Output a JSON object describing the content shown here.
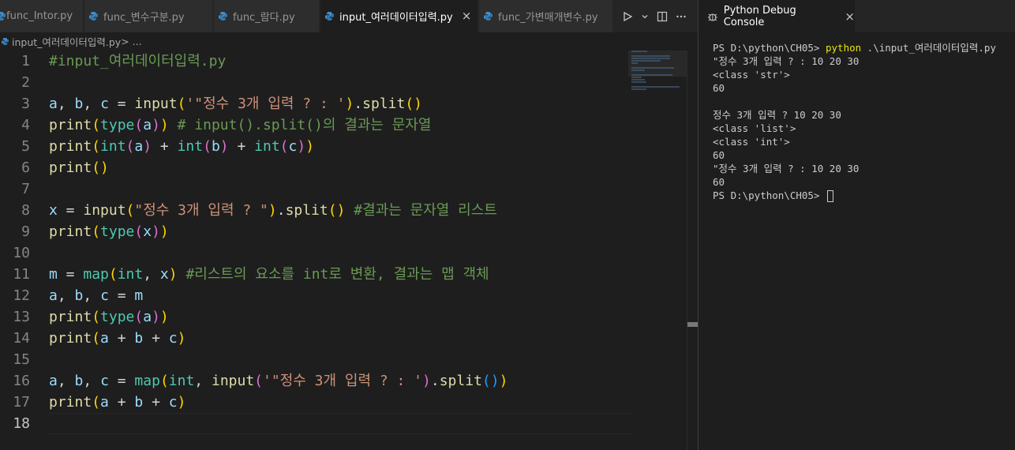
{
  "tabs": [
    {
      "label": "func_Intor.py",
      "active": false
    },
    {
      "label": "func_변수구분.py",
      "active": false
    },
    {
      "label": "func_람다.py",
      "active": false
    },
    {
      "label": "input_여러데이터입력.py",
      "active": true
    },
    {
      "label": "func_가변매개변수.py",
      "active": false
    }
  ],
  "tab_close_glyph": "×",
  "breadcrumb": {
    "file": "input_여러데이터입력.py",
    "rest": " > ..."
  },
  "editor": {
    "current_line": 18,
    "lines": [
      {
        "n": "1",
        "segments": [
          {
            "t": "#input_여러데이터입력.py",
            "c": "com"
          }
        ]
      },
      {
        "n": "2",
        "segments": []
      },
      {
        "n": "3",
        "segments": [
          {
            "t": "a",
            "c": "var"
          },
          {
            "t": ", ",
            "c": "op"
          },
          {
            "t": "b",
            "c": "var"
          },
          {
            "t": ", ",
            "c": "op"
          },
          {
            "t": "c",
            "c": "var"
          },
          {
            "t": " = ",
            "c": "op"
          },
          {
            "t": "input",
            "c": "fn"
          },
          {
            "t": "(",
            "c": "p1"
          },
          {
            "t": "'\"정수 3개 입력 ? : '",
            "c": "str"
          },
          {
            "t": ")",
            "c": "p1"
          },
          {
            "t": ".",
            "c": "op"
          },
          {
            "t": "split",
            "c": "fn"
          },
          {
            "t": "()",
            "c": "p1"
          }
        ]
      },
      {
        "n": "4",
        "segments": [
          {
            "t": "print",
            "c": "fn"
          },
          {
            "t": "(",
            "c": "p1"
          },
          {
            "t": "type",
            "c": "type"
          },
          {
            "t": "(",
            "c": "p2"
          },
          {
            "t": "a",
            "c": "var"
          },
          {
            "t": ")",
            "c": "p2"
          },
          {
            "t": ")",
            "c": "p1"
          },
          {
            "t": " # input().split()의 결과는 문자열",
            "c": "com"
          }
        ]
      },
      {
        "n": "5",
        "segments": [
          {
            "t": "print",
            "c": "fn"
          },
          {
            "t": "(",
            "c": "p1"
          },
          {
            "t": "int",
            "c": "type"
          },
          {
            "t": "(",
            "c": "p2"
          },
          {
            "t": "a",
            "c": "var"
          },
          {
            "t": ")",
            "c": "p2"
          },
          {
            "t": " + ",
            "c": "op"
          },
          {
            "t": "int",
            "c": "type"
          },
          {
            "t": "(",
            "c": "p2"
          },
          {
            "t": "b",
            "c": "var"
          },
          {
            "t": ")",
            "c": "p2"
          },
          {
            "t": " + ",
            "c": "op"
          },
          {
            "t": "int",
            "c": "type"
          },
          {
            "t": "(",
            "c": "p2"
          },
          {
            "t": "c",
            "c": "var"
          },
          {
            "t": ")",
            "c": "p2"
          },
          {
            "t": ")",
            "c": "p1"
          }
        ]
      },
      {
        "n": "6",
        "segments": [
          {
            "t": "print",
            "c": "fn"
          },
          {
            "t": "()",
            "c": "p1"
          }
        ]
      },
      {
        "n": "7",
        "segments": []
      },
      {
        "n": "8",
        "segments": [
          {
            "t": "x",
            "c": "var"
          },
          {
            "t": " = ",
            "c": "op"
          },
          {
            "t": "input",
            "c": "fn"
          },
          {
            "t": "(",
            "c": "p1"
          },
          {
            "t": "\"정수 3개 입력 ? \"",
            "c": "str"
          },
          {
            "t": ")",
            "c": "p1"
          },
          {
            "t": ".",
            "c": "op"
          },
          {
            "t": "split",
            "c": "fn"
          },
          {
            "t": "()",
            "c": "p1"
          },
          {
            "t": " #결과는 문자열 리스트",
            "c": "com"
          }
        ]
      },
      {
        "n": "9",
        "segments": [
          {
            "t": "print",
            "c": "fn"
          },
          {
            "t": "(",
            "c": "p1"
          },
          {
            "t": "type",
            "c": "type"
          },
          {
            "t": "(",
            "c": "p2"
          },
          {
            "t": "x",
            "c": "var"
          },
          {
            "t": ")",
            "c": "p2"
          },
          {
            "t": ")",
            "c": "p1"
          }
        ]
      },
      {
        "n": "10",
        "segments": []
      },
      {
        "n": "11",
        "segments": [
          {
            "t": "m",
            "c": "var"
          },
          {
            "t": " = ",
            "c": "op"
          },
          {
            "t": "map",
            "c": "type"
          },
          {
            "t": "(",
            "c": "p1"
          },
          {
            "t": "int",
            "c": "type"
          },
          {
            "t": ", ",
            "c": "op"
          },
          {
            "t": "x",
            "c": "var"
          },
          {
            "t": ")",
            "c": "p1"
          },
          {
            "t": " #리스트의 요소를 int로 변환, 결과는 맵 객체",
            "c": "com"
          }
        ]
      },
      {
        "n": "12",
        "segments": [
          {
            "t": "a",
            "c": "var"
          },
          {
            "t": ", ",
            "c": "op"
          },
          {
            "t": "b",
            "c": "var"
          },
          {
            "t": ", ",
            "c": "op"
          },
          {
            "t": "c",
            "c": "var"
          },
          {
            "t": " = ",
            "c": "op"
          },
          {
            "t": "m",
            "c": "var"
          }
        ]
      },
      {
        "n": "13",
        "segments": [
          {
            "t": "print",
            "c": "fn"
          },
          {
            "t": "(",
            "c": "p1"
          },
          {
            "t": "type",
            "c": "type"
          },
          {
            "t": "(",
            "c": "p2"
          },
          {
            "t": "a",
            "c": "var"
          },
          {
            "t": ")",
            "c": "p2"
          },
          {
            "t": ")",
            "c": "p1"
          }
        ]
      },
      {
        "n": "14",
        "segments": [
          {
            "t": "print",
            "c": "fn"
          },
          {
            "t": "(",
            "c": "p1"
          },
          {
            "t": "a",
            "c": "var"
          },
          {
            "t": " + ",
            "c": "op"
          },
          {
            "t": "b",
            "c": "var"
          },
          {
            "t": " + ",
            "c": "op"
          },
          {
            "t": "c",
            "c": "var"
          },
          {
            "t": ")",
            "c": "p1"
          }
        ]
      },
      {
        "n": "15",
        "segments": []
      },
      {
        "n": "16",
        "segments": [
          {
            "t": "a",
            "c": "var"
          },
          {
            "t": ", ",
            "c": "op"
          },
          {
            "t": "b",
            "c": "var"
          },
          {
            "t": ", ",
            "c": "op"
          },
          {
            "t": "c",
            "c": "var"
          },
          {
            "t": " = ",
            "c": "op"
          },
          {
            "t": "map",
            "c": "type"
          },
          {
            "t": "(",
            "c": "p1"
          },
          {
            "t": "int",
            "c": "type"
          },
          {
            "t": ", ",
            "c": "op"
          },
          {
            "t": "input",
            "c": "fn"
          },
          {
            "t": "(",
            "c": "p2"
          },
          {
            "t": "'\"정수 3개 입력 ? : '",
            "c": "str"
          },
          {
            "t": ")",
            "c": "p2"
          },
          {
            "t": ".",
            "c": "op"
          },
          {
            "t": "split",
            "c": "fn"
          },
          {
            "t": "()",
            "c": "p3"
          },
          {
            "t": ")",
            "c": "p1"
          }
        ]
      },
      {
        "n": "17",
        "segments": [
          {
            "t": "print",
            "c": "fn"
          },
          {
            "t": "(",
            "c": "p1"
          },
          {
            "t": "a",
            "c": "var"
          },
          {
            "t": " + ",
            "c": "op"
          },
          {
            "t": "b",
            "c": "var"
          },
          {
            "t": " + ",
            "c": "op"
          },
          {
            "t": "c",
            "c": "var"
          },
          {
            "t": ")",
            "c": "p1"
          }
        ]
      },
      {
        "n": "18",
        "segments": []
      }
    ]
  },
  "panel": {
    "tab_label": "Python Debug Console",
    "console_lines": [
      {
        "text": "PS D:\\python\\CH05> ",
        "cmd": "python",
        "rest": " .\\input_여러데이터입력.py"
      },
      {
        "text": "\"정수 3개 입력 ? : 10 20 30"
      },
      {
        "text": "<class 'str'>"
      },
      {
        "text": "60"
      },
      {
        "text": ""
      },
      {
        "text": "정수 3개 입력 ? 10 20 30"
      },
      {
        "text": "<class 'list'>"
      },
      {
        "text": "<class 'int'>"
      },
      {
        "text": "60"
      },
      {
        "text": "\"정수 3개 입력 ? : 10 20 30"
      },
      {
        "text": "60"
      },
      {
        "text": "PS D:\\python\\CH05> ",
        "cursor": true
      }
    ]
  },
  "icons": {
    "tab_file": "python-file-icon",
    "run": "run-icon",
    "run_dropdown": "chevron-down-icon",
    "split": "split-editor-icon",
    "more": "more-actions-icon",
    "debug_console": "bug-icon"
  },
  "colors": {
    "editor_bg": "#1e1e1e",
    "tab_active_fg": "#ffffff",
    "comment": "#6a9955",
    "string": "#ce9178",
    "function": "#dcdcaa",
    "variable": "#9cdcfe",
    "builtin_type": "#4ec9b0",
    "bracket_1": "#ffd700",
    "bracket_2": "#da70d6",
    "bracket_3": "#179fff",
    "terminal_command": "#e5e510"
  }
}
